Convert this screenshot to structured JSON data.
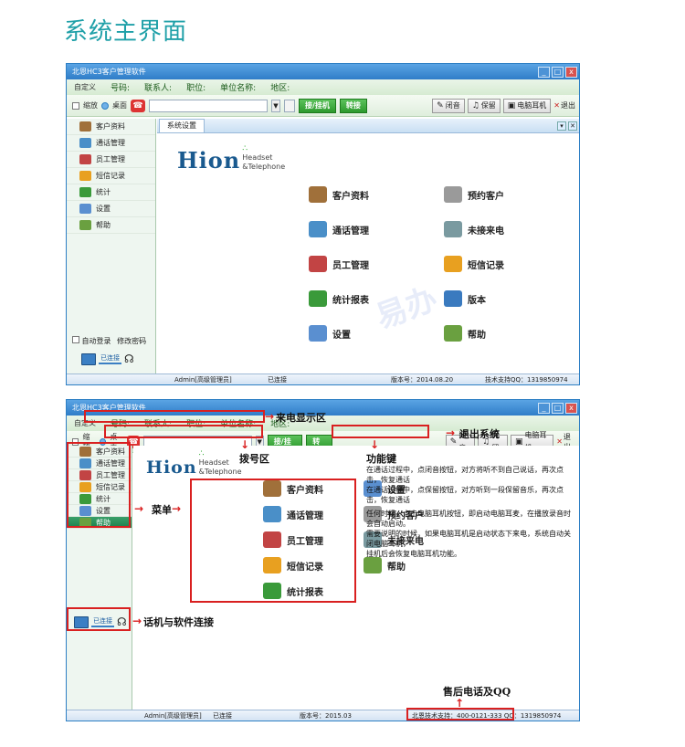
{
  "page_title": "系统主界面",
  "window": {
    "title": "北恩HC3客户管理软件",
    "controls": {
      "minimize": "_",
      "maximize": "□",
      "close": "x"
    }
  },
  "infobar": {
    "custom": "自定义",
    "fields": [
      "号码:",
      "联系人:",
      "职位:",
      "单位名称:",
      "地区:"
    ]
  },
  "toolbar": {
    "shrink": "缩放",
    "desktop": "桌面",
    "answer_hangup": "接/挂机",
    "transfer": "转接",
    "mute": "闭音",
    "hold": "保留",
    "pc_headset": "电脑耳机",
    "exit": "退出"
  },
  "sidebar": {
    "items": [
      {
        "label": "客户资料",
        "icon": "contact-card-icon",
        "color": "#a0703a"
      },
      {
        "label": "通话管理",
        "icon": "call-manager-icon",
        "color": "#4a8fc8"
      },
      {
        "label": "员工管理",
        "icon": "staff-icon",
        "color": "#c24444"
      },
      {
        "label": "短信记录",
        "icon": "envelope-icon",
        "color": "#e8a020"
      },
      {
        "label": "统计",
        "icon": "bar-chart-icon",
        "color": "#3a9a3a"
      },
      {
        "label": "设置",
        "icon": "settings-icon",
        "color": "#5a8fd0"
      },
      {
        "label": "帮助",
        "icon": "help-icon",
        "color": "#6aa040"
      }
    ],
    "auto_login": "自动登录",
    "change_password": "修改密码",
    "connected": "已连接"
  },
  "tabs": [
    {
      "label": "系统设置"
    }
  ],
  "logo": {
    "main": "Hion",
    "sub1": "Headset",
    "sub2": "&Telephone"
  },
  "features": [
    {
      "label": "客户资料",
      "icon": "contact-card-icon",
      "color": "#a0703a"
    },
    {
      "label": "预约客户",
      "icon": "alarm-clock-icon",
      "color": "#9a9a9a"
    },
    {
      "label": "通话管理",
      "icon": "call-manager-icon",
      "color": "#4a8fc8"
    },
    {
      "label": "未接来电",
      "icon": "missed-call-icon",
      "color": "#7a9aa0"
    },
    {
      "label": "员工管理",
      "icon": "staff-icon",
      "color": "#c24444"
    },
    {
      "label": "短信记录",
      "icon": "envelope-icon",
      "color": "#e8a020"
    },
    {
      "label": "统计报表",
      "icon": "bar-chart-icon",
      "color": "#3a9a3a"
    },
    {
      "label": "版本",
      "icon": "book-icon",
      "color": "#3a7abf"
    },
    {
      "label": "设置",
      "icon": "settings-icon",
      "color": "#5a8fd0"
    },
    {
      "label": "帮助",
      "icon": "help-icon",
      "color": "#6aa040"
    }
  ],
  "status": {
    "user": "Admin[高级管理员]",
    "conn": "已连接",
    "version": "版本号：2014.08.20",
    "support": "技术支持QQ：1319850974"
  },
  "status2": {
    "user": "Admin[高级管理员]",
    "conn": "已连接",
    "version": "版本号：2015.03",
    "support": "北恩技术支持：400-0121-333 QQ：1319850974"
  },
  "features2": [
    {
      "label": "客户资料",
      "icon": "contact-card-icon",
      "color": "#a0703a"
    },
    {
      "label": "设置",
      "icon": "settings-icon",
      "color": "#5a8fd0"
    },
    {
      "label": "通话管理",
      "icon": "call-manager-icon",
      "color": "#4a8fc8"
    },
    {
      "label": "预约客户",
      "icon": "alarm-clock-icon",
      "color": "#9a9a9a"
    },
    {
      "label": "员工管理",
      "icon": "staff-icon",
      "color": "#c24444"
    },
    {
      "label": "未接来电",
      "icon": "missed-call-icon",
      "color": "#7a9aa0"
    },
    {
      "label": "短信记录",
      "icon": "envelope-icon",
      "color": "#e8a020"
    },
    {
      "label": "帮助",
      "icon": "help-icon",
      "color": "#6aa040"
    },
    {
      "label": "统计报表",
      "icon": "bar-chart-icon",
      "color": "#3a9a3a"
    }
  ],
  "annotations": {
    "callerid_area": "来电显示区",
    "dial_area": "拨号区",
    "exit_system": "退出系统",
    "function_keys": "功能键",
    "menu": "菜单",
    "phone_link": "话机与软件连接",
    "after_sales": "售后电话及QQ",
    "desc_lines": [
      "在通话过程中，点闭音按钮，对方将听不到自己说话，再次点击，恢复通话",
      "在通话过程中，点保留按钮，对方听到一段保留音乐，再次点击，恢复通话",
      "任何时候，点击电脑耳机按钮，即启动电脑耳麦，在播放录音时会自动启动。",
      "需要说明的时候，如果电脑耳机是启动状态下来电，系统自动关闭电脑耳机，",
      "挂机后会恢复电脑耳机功能。"
    ]
  },
  "watermark": "易办",
  "colors": {
    "accent": "#1fa0a8",
    "window_border": "#2d7fc4",
    "highlight": "#d92020"
  }
}
